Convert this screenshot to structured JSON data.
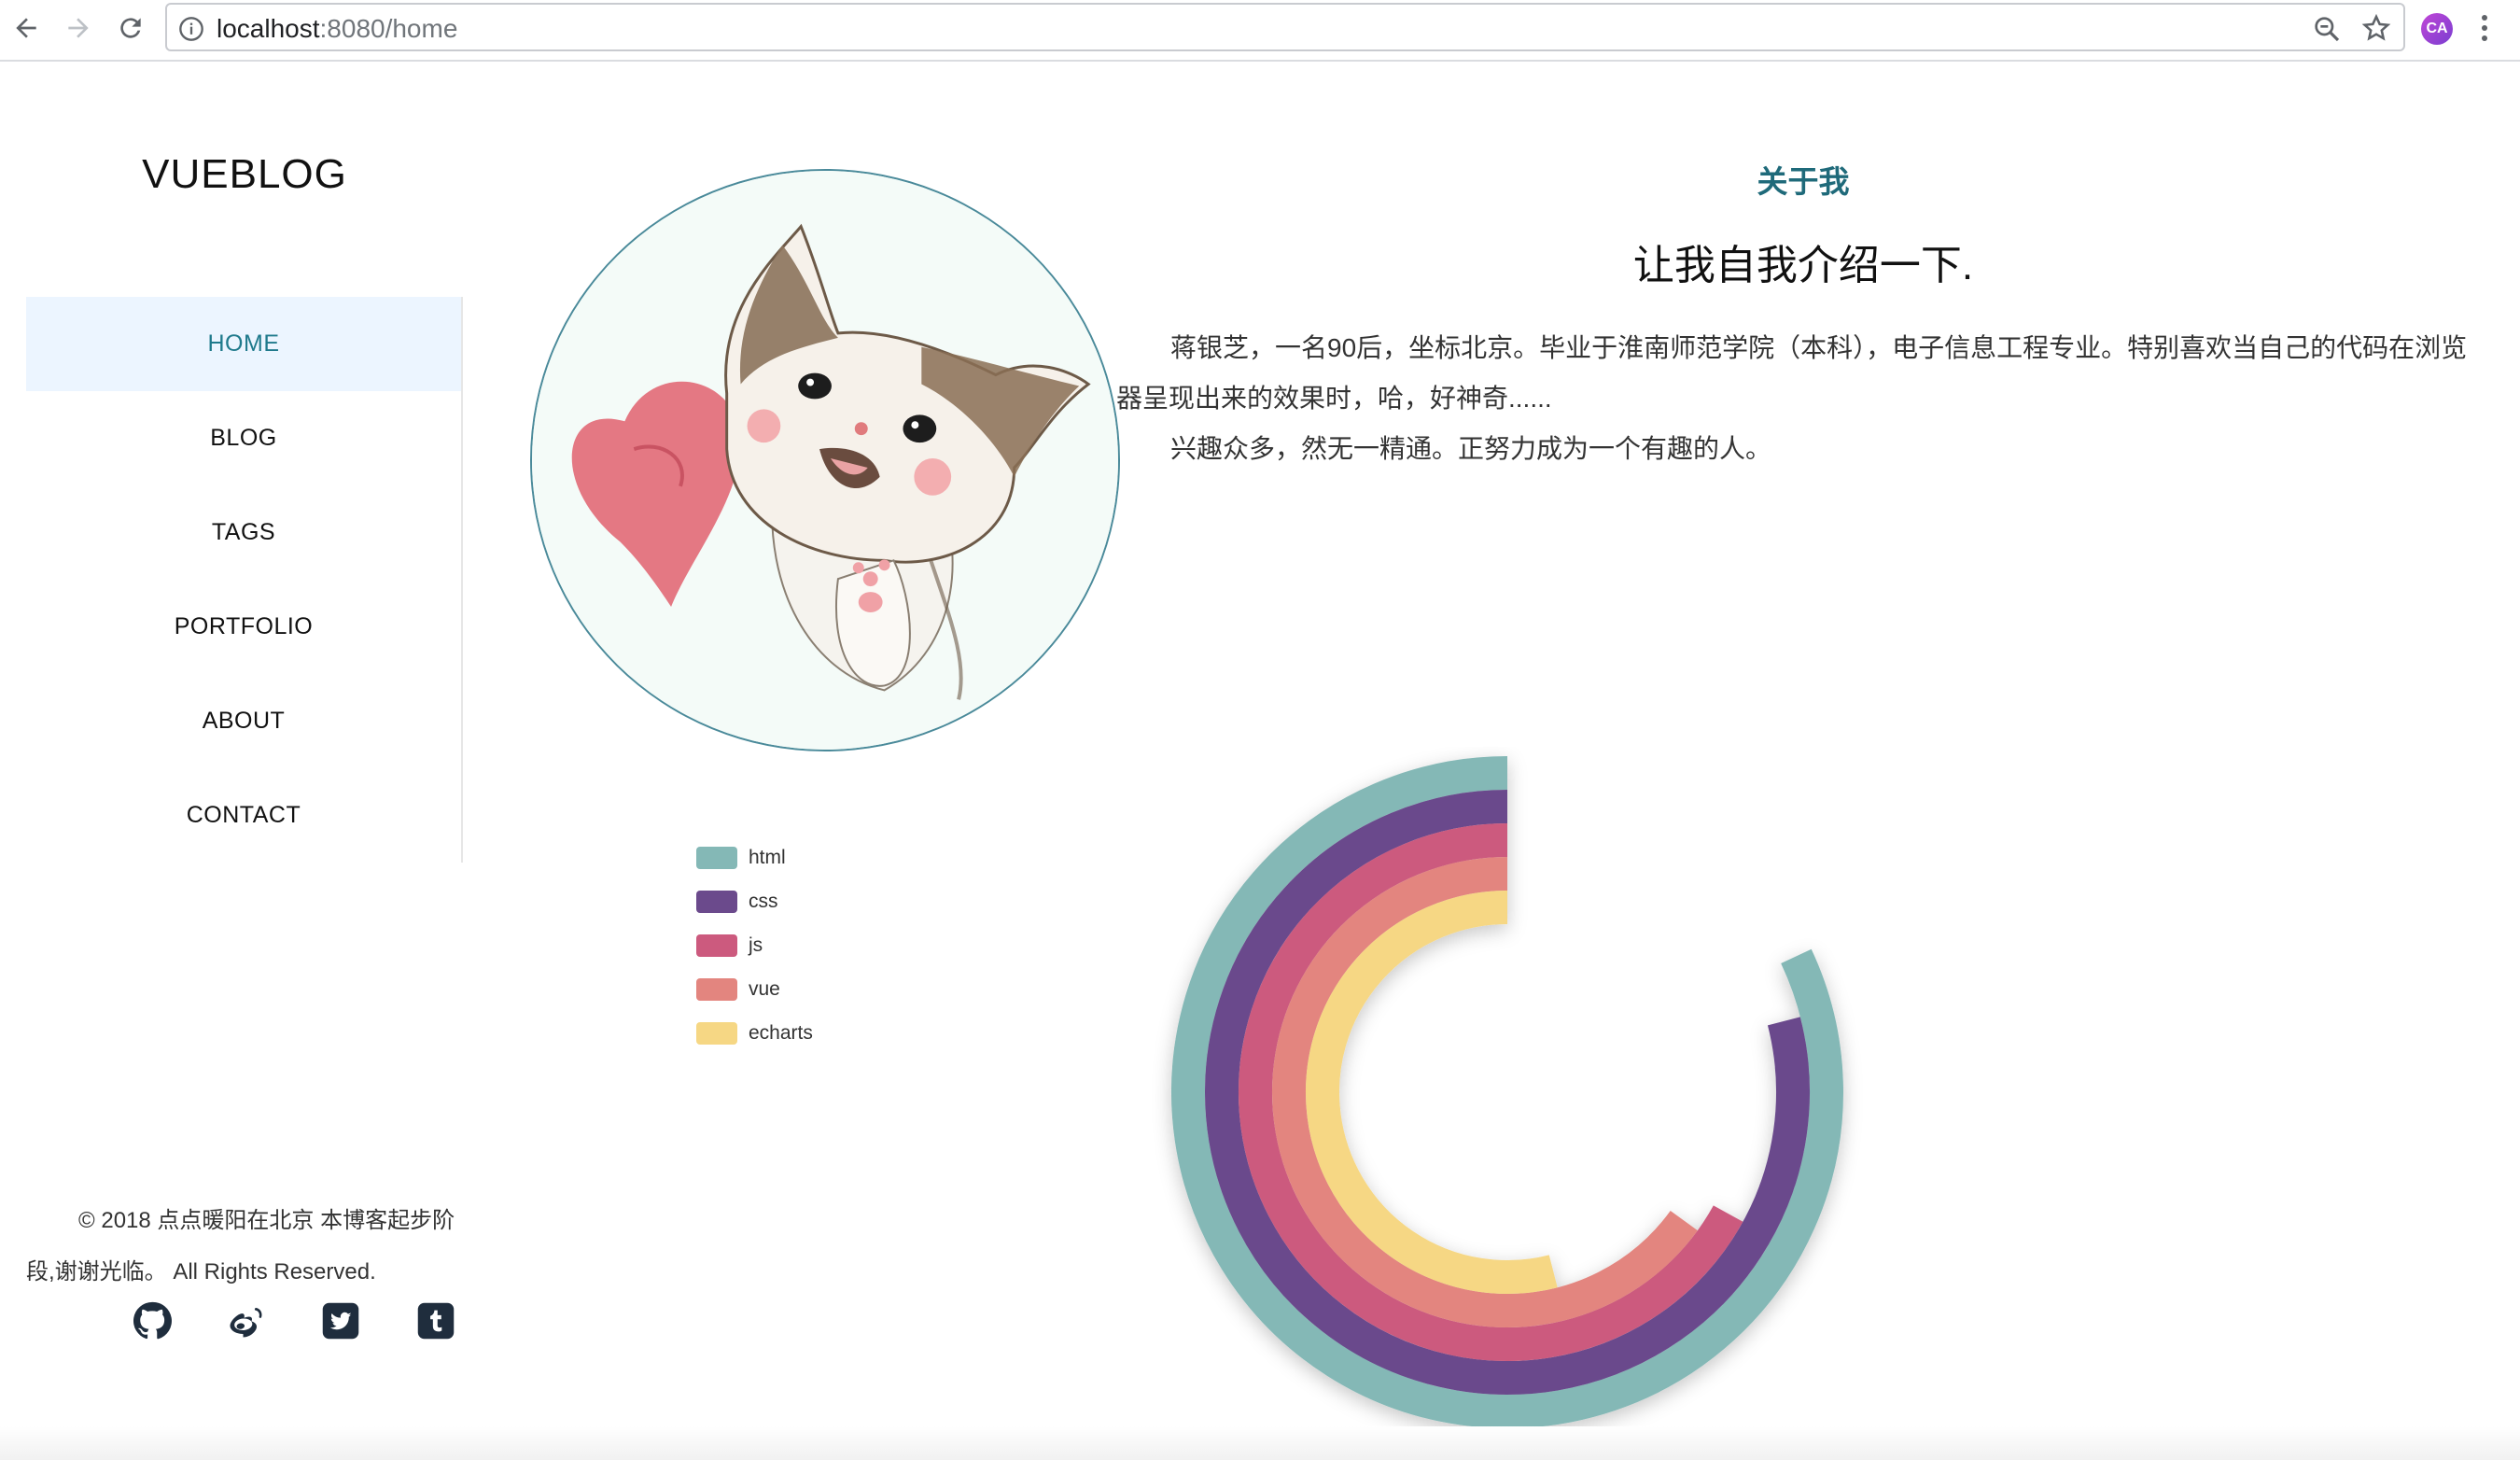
{
  "browser": {
    "url_host": "localhost",
    "url_path": ":8080/home",
    "back_icon": "arrow-left-icon",
    "forward_icon": "arrow-right-icon",
    "reload_icon": "reload-icon",
    "profile_initials": "CA"
  },
  "sidebar": {
    "logo": "VUEBLOG",
    "nav": [
      {
        "label": "HOME"
      },
      {
        "label": "BLOG"
      },
      {
        "label": "TAGS"
      },
      {
        "label": "PORTFOLIO"
      },
      {
        "label": "ABOUT"
      },
      {
        "label": "CONTACT"
      }
    ],
    "footer": "© 2018 点点暖阳在北京 本博客起步阶段,谢谢光临。 All Rights Reserved.",
    "social": [
      "github-icon",
      "weibo-icon",
      "twitter-icon",
      "tumblr-icon"
    ]
  },
  "about": {
    "kicker": "关于我",
    "title": "让我自我介绍一下.",
    "paragraph1": "蒋银芝，一名90后，坐标北京。毕业于淮南师范学院（本科），电子信息工程专业。特别喜欢当自己的代码在浏览器呈现出来的效果时，哈，好神奇......",
    "paragraph2": "兴趣众多，然无一精通。正努力成为一个有趣的人。"
  },
  "colors": {
    "accent": "#1f7a8c",
    "active_nav_bg": "#ecf5ff"
  },
  "chart_data": {
    "type": "polar-bar",
    "series": [
      {
        "name": "html",
        "value": 0.82,
        "color": "#84b8b6"
      },
      {
        "name": "css",
        "value": 0.79,
        "color": "#6b4a8c"
      },
      {
        "name": "js",
        "value": 0.67,
        "color": "#cc5a7e"
      },
      {
        "name": "vue",
        "value": 0.65,
        "color": "#e3857f"
      },
      {
        "name": "echarts",
        "value": 0.54,
        "color": "#f6d784"
      }
    ],
    "legend_position": "left"
  }
}
